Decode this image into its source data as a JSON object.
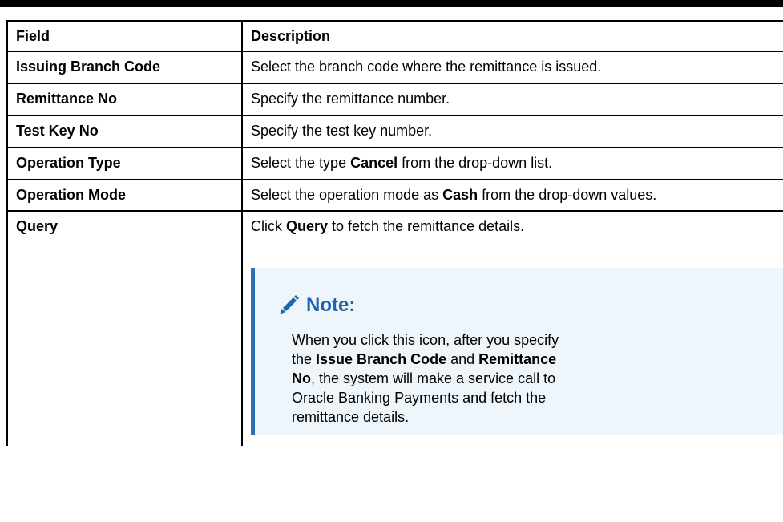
{
  "table": {
    "headers": {
      "field": "Field",
      "description": "Description"
    },
    "rows": [
      {
        "field": "Issuing Branch Code",
        "description": "Select the branch code where the remittance is issued."
      },
      {
        "field": "Remittance No",
        "description": "Specify the remittance number."
      },
      {
        "field": "Test Key No",
        "description": "Specify the test key number."
      },
      {
        "field": "Operation Type",
        "description_pre": "Select the type ",
        "description_bold": "Cancel",
        "description_post": " from the drop-down list."
      },
      {
        "field": "Operation Mode",
        "description_pre": "Select the operation mode as ",
        "description_bold": "Cash",
        "description_post": " from the drop-down values."
      },
      {
        "field": "Query",
        "description_pre": "Click ",
        "description_bold": "Query",
        "description_post": " to fetch the remittance details."
      }
    ]
  },
  "note": {
    "icon": "pencil-icon",
    "title": "Note:",
    "text_1": "When you click this icon, after you specify the ",
    "bold_1": "Issue Branch Code",
    "text_2": " and ",
    "bold_2": "Remittance No",
    "text_3": ", the system will make a service call to Oracle Banking Payments and fetch the remittance details."
  },
  "colors": {
    "note_background": "#eef5fb",
    "note_accent": "#2f6fb3",
    "note_title": "#1f64ad",
    "rule": "#000000"
  }
}
